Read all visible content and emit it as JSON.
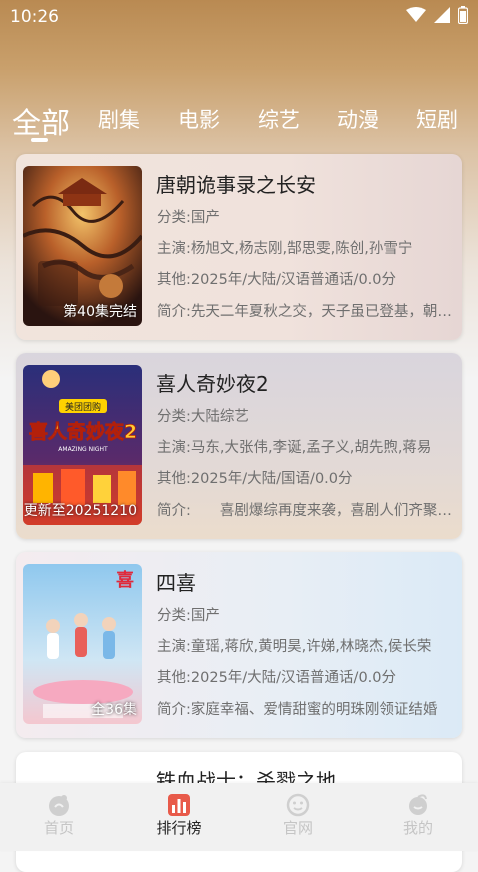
{
  "status": {
    "time": "10:26"
  },
  "tabs": [
    {
      "label": "全部",
      "active": true
    },
    {
      "label": "剧集"
    },
    {
      "label": "电影"
    },
    {
      "label": "综艺"
    },
    {
      "label": "动漫"
    },
    {
      "label": "短剧"
    }
  ],
  "cards": [
    {
      "title": "唐朝诡事录之长安",
      "badge": "第40集完结",
      "category_label": "分类:",
      "category": "国产",
      "cast_label": "主演:",
      "cast": "杨旭文,杨志刚,郜思雯,陈创,孙雪宁",
      "other_label": "其他:",
      "other": "2025年/大陆/汉语普通话/0.0分",
      "intro_label": "简介:",
      "intro": "先天二年夏秋之交，天子虽已登基，朝局却暗流涌动"
    },
    {
      "title": "喜人奇妙夜2",
      "badge": "更新至20251210",
      "category_label": "分类:",
      "category": "大陆综艺",
      "cast_label": "主演:",
      "cast": "马东,大张伟,李诞,孟子义,胡先煦,蒋易",
      "other_label": "其他:",
      "other": "2025年/大陆/国语/0.0分",
      "intro_label": "简介:",
      "intro": "　　喜剧爆综再度来袭，喜剧人们齐聚一堂",
      "poster_brand": "美团团购",
      "poster_title": "喜人奇妙夜2",
      "poster_sub": "AMAZING NIGHT"
    },
    {
      "title": "四喜",
      "badge": "全36集",
      "category_label": "分类:",
      "category": "国产",
      "cast_label": "主演:",
      "cast": "童瑶,蒋欣,黄明昊,许娣,林晓杰,侯长荣",
      "other_label": "其他:",
      "other": "2025年/大陆/汉语普通话/0.0分",
      "intro_label": "简介:",
      "intro": "家庭幸福、爱情甜蜜的明珠刚领证结婚",
      "poster_mark": "喜"
    },
    {
      "title": "铁血战士：杀戮之地"
    }
  ],
  "nav": [
    {
      "label": "首页",
      "icon": "home-icon"
    },
    {
      "label": "排行榜",
      "icon": "ranking-icon",
      "active": true
    },
    {
      "label": "官网",
      "icon": "website-icon"
    },
    {
      "label": "我的",
      "icon": "profile-icon"
    }
  ],
  "colors": {
    "header_gradient_top": "#b98a52",
    "active_text": "#222222",
    "inactive_nav": "#c5c5c5"
  }
}
